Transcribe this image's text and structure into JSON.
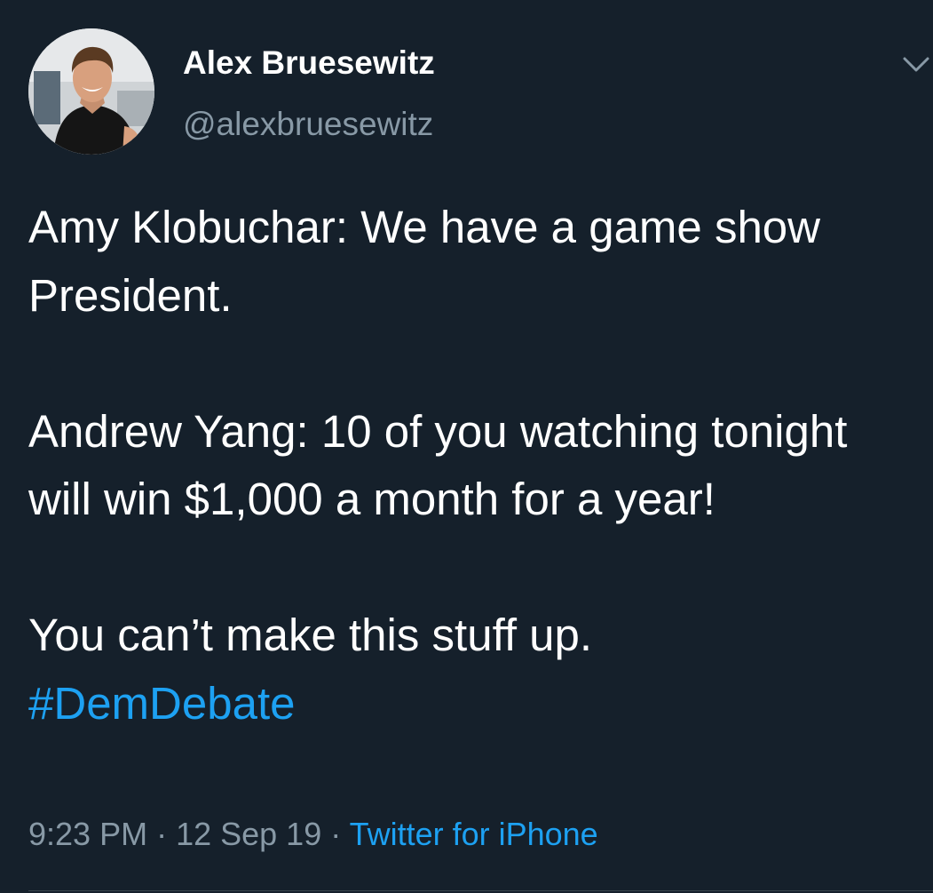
{
  "author": {
    "display_name": "Alex Bruesewitz",
    "handle": "@alexbruesewitz"
  },
  "tweet": {
    "line1": "Amy Klobuchar: We have a game show President.",
    "line2": "Andrew Yang: 10 of you watching tonight will win $1,000 a month for a year!",
    "line3": "You can’t make this stuff up.",
    "hashtag": "#DemDebate"
  },
  "meta": {
    "time": "9:23 PM",
    "separator": " · ",
    "date": "12 Sep 19",
    "source": "Twitter for iPhone"
  },
  "icons": {
    "chevron": "chevron-down-icon"
  },
  "colors": {
    "background": "#15202b",
    "text": "#ffffff",
    "secondary_text": "#8899a6",
    "link": "#1da1f2"
  }
}
